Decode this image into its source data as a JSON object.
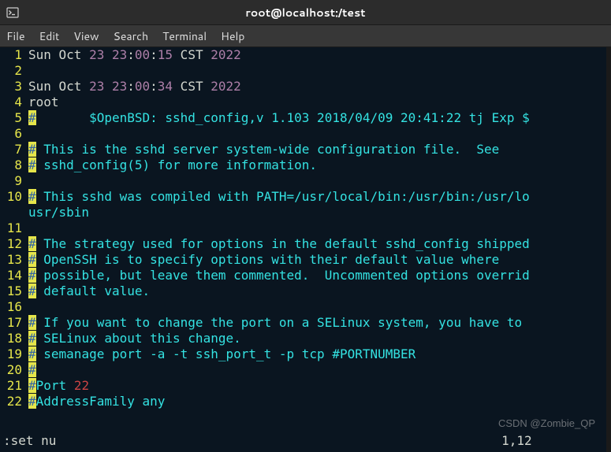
{
  "titlebar": {
    "title": "root@localhost:/test"
  },
  "menubar": {
    "items": [
      "File",
      "Edit",
      "View",
      "Search",
      "Terminal",
      "Help"
    ]
  },
  "colors": {
    "bg": "#0a1520",
    "gutter": "#e5e54a",
    "text": "#d3d7cf",
    "keyword": "#34e2e2",
    "number": "#ad7fa8",
    "red": "#cc4444",
    "hl_bg": "#e5e54a",
    "hl_fg": "#3465a4"
  },
  "editor": {
    "lines": [
      {
        "n": 1,
        "segments": [
          {
            "t": "Sun Oct ",
            "c": "white"
          },
          {
            "t": "23",
            "c": "purple"
          },
          {
            "t": " ",
            "c": "white"
          },
          {
            "t": "23",
            "c": "purple"
          },
          {
            "t": ":",
            "c": "white"
          },
          {
            "t": "00",
            "c": "purple"
          },
          {
            "t": ":",
            "c": "white"
          },
          {
            "t": "15",
            "c": "purple"
          },
          {
            "t": " CST ",
            "c": "white"
          },
          {
            "t": "2022",
            "c": "purple"
          }
        ]
      },
      {
        "n": 2,
        "segments": []
      },
      {
        "n": 3,
        "segments": [
          {
            "t": "Sun Oct ",
            "c": "white"
          },
          {
            "t": "23",
            "c": "purple"
          },
          {
            "t": " ",
            "c": "white"
          },
          {
            "t": "23",
            "c": "purple"
          },
          {
            "t": ":",
            "c": "white"
          },
          {
            "t": "00",
            "c": "purple"
          },
          {
            "t": ":",
            "c": "white"
          },
          {
            "t": "34",
            "c": "purple"
          },
          {
            "t": " CST ",
            "c": "white"
          },
          {
            "t": "2022",
            "c": "purple"
          }
        ]
      },
      {
        "n": 4,
        "segments": [
          {
            "t": "root",
            "c": "white"
          }
        ]
      },
      {
        "n": 5,
        "segments": [
          {
            "t": "#",
            "c": "hl"
          },
          {
            "t": "       $OpenBSD: sshd_config,v 1.103 2018/04/09 20:41:22 tj Exp $",
            "c": "teal"
          }
        ]
      },
      {
        "n": 6,
        "segments": []
      },
      {
        "n": 7,
        "segments": [
          {
            "t": "#",
            "c": "hl"
          },
          {
            "t": " This is the sshd server system-wide configuration file.  See",
            "c": "teal"
          }
        ]
      },
      {
        "n": 8,
        "segments": [
          {
            "t": "#",
            "c": "hl"
          },
          {
            "t": " sshd_config(5) for more information.",
            "c": "teal"
          }
        ]
      },
      {
        "n": 9,
        "segments": []
      },
      {
        "n": 10,
        "segments": [
          {
            "t": "#",
            "c": "hl"
          },
          {
            "t": " This sshd was compiled with PATH=/usr/local/bin:/usr/bin:/usr/lo",
            "c": "teal"
          }
        ]
      },
      {
        "n": null,
        "segments": [
          {
            "t": "usr/sbin",
            "c": "teal"
          }
        ]
      },
      {
        "n": 11,
        "segments": []
      },
      {
        "n": 12,
        "segments": [
          {
            "t": "#",
            "c": "hl"
          },
          {
            "t": " The strategy used for options in the default sshd_config shipped",
            "c": "teal"
          }
        ]
      },
      {
        "n": 13,
        "segments": [
          {
            "t": "#",
            "c": "hl"
          },
          {
            "t": " OpenSSH is to specify options with their default value where",
            "c": "teal"
          }
        ]
      },
      {
        "n": 14,
        "segments": [
          {
            "t": "#",
            "c": "hl"
          },
          {
            "t": " possible, but leave them commented.  Uncommented options overrid",
            "c": "teal"
          }
        ]
      },
      {
        "n": 15,
        "segments": [
          {
            "t": "#",
            "c": "hl"
          },
          {
            "t": " default value.",
            "c": "teal"
          }
        ]
      },
      {
        "n": 16,
        "segments": []
      },
      {
        "n": 17,
        "segments": [
          {
            "t": "#",
            "c": "hl"
          },
          {
            "t": " If you want to change the port on a SELinux system, you have to ",
            "c": "teal"
          }
        ]
      },
      {
        "n": 18,
        "segments": [
          {
            "t": "#",
            "c": "hl"
          },
          {
            "t": " SELinux about this change.",
            "c": "teal"
          }
        ]
      },
      {
        "n": 19,
        "segments": [
          {
            "t": "#",
            "c": "hl"
          },
          {
            "t": " semanage port -a -t ssh_port_t -p tcp #PORTNUMBER",
            "c": "teal"
          }
        ]
      },
      {
        "n": 20,
        "segments": [
          {
            "t": "#",
            "c": "hl"
          }
        ]
      },
      {
        "n": 21,
        "segments": [
          {
            "t": "#",
            "c": "hl"
          },
          {
            "t": "Port ",
            "c": "teal"
          },
          {
            "t": "22",
            "c": "red"
          }
        ]
      },
      {
        "n": 22,
        "segments": [
          {
            "t": "#",
            "c": "hl"
          },
          {
            "t": "AddressFamily any",
            "c": "teal"
          }
        ]
      }
    ],
    "status_left": ":set nu",
    "status_right": "1,12          ",
    "watermark": "CSDN @Zombie_QP"
  }
}
